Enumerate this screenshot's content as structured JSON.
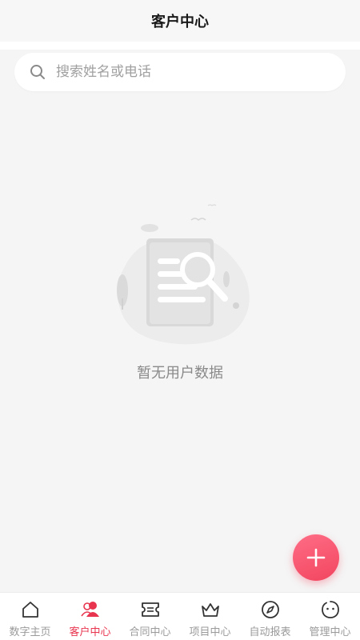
{
  "header": {
    "title": "客户中心"
  },
  "search": {
    "placeholder": "搜索姓名或电话"
  },
  "empty_state": {
    "message": "暂无用户数据"
  },
  "fab": {
    "icon": "plus-icon",
    "color": "#f2455f"
  },
  "tabbar": {
    "active_color": "#e8344e",
    "items": [
      {
        "label": "数字主页",
        "icon": "home-icon",
        "active": false
      },
      {
        "label": "客户中心",
        "icon": "customers-icon",
        "active": true
      },
      {
        "label": "合同中心",
        "icon": "ticket-icon",
        "active": false
      },
      {
        "label": "项目中心",
        "icon": "crown-icon",
        "active": false
      },
      {
        "label": "自动报表",
        "icon": "compass-icon",
        "active": false
      },
      {
        "label": "管理中心",
        "icon": "smiley-face-icon",
        "active": false
      }
    ]
  }
}
